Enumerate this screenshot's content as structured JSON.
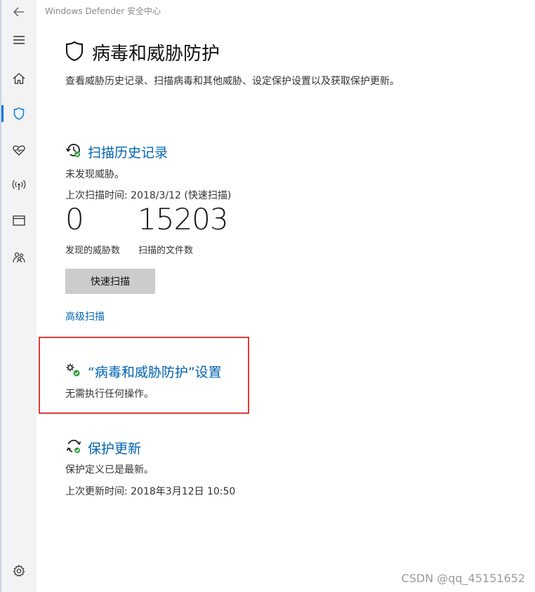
{
  "window": {
    "title": "Windows Defender 安全中心"
  },
  "sidebar": {
    "items": [
      {
        "icon": "back-arrow-icon"
      },
      {
        "icon": "menu-icon"
      },
      {
        "icon": "home-icon"
      },
      {
        "icon": "shield-icon",
        "active": true
      },
      {
        "icon": "heart-icon"
      },
      {
        "icon": "wireless-icon"
      },
      {
        "icon": "browser-window-icon"
      },
      {
        "icon": "family-icon"
      },
      {
        "icon": "settings-gear-icon"
      }
    ],
    "accent_color": "#0078d7"
  },
  "page": {
    "title": "病毒和威胁防护",
    "description": "查看威胁历史记录、扫描病毒和其他威胁、设定保护设置以及获取保护更新。"
  },
  "scan_history": {
    "title": "扫描历史记录",
    "status": "未发现威胁。",
    "last_scan": "上次扫描时间: 2018/3/12 (快速扫描)",
    "threats_found": "0",
    "threats_found_label": "发现的威胁数",
    "files_scanned": "15203",
    "files_scanned_label": "扫描的文件数",
    "quick_scan_button": "快速扫描",
    "advanced_scan_link": "高级扫描"
  },
  "protection_settings": {
    "title": "“病毒和威胁防护”设置",
    "status": "无需执行任何操作。",
    "highlight_color": "#e03a3a"
  },
  "protection_updates": {
    "title": "保护更新",
    "status": "保护定义已是最新。",
    "last_update": "上次更新时间: 2018年3月12日 10:50"
  },
  "watermark": "CSDN @qq_45151652",
  "colors": {
    "link": "#0063b1",
    "button_bg": "#cccccc",
    "status_green": "#2e9d3f"
  }
}
